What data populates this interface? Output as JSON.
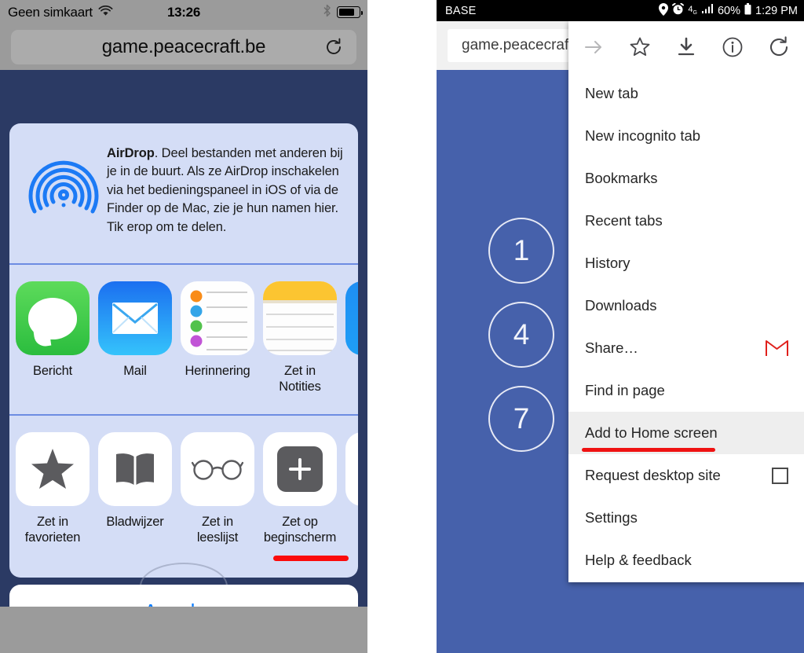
{
  "ios": {
    "status_bar": {
      "carrier": "Geen simkaart",
      "wifi_icon": "wifi-icon",
      "time": "13:26",
      "bluetooth_icon": "bluetooth-icon",
      "battery_icon": "battery-icon"
    },
    "browser": {
      "url": "game.peacecraft.be",
      "reload_icon": "reload-icon"
    },
    "share_sheet": {
      "airdrop": {
        "icon": "airdrop-icon",
        "title": "AirDrop",
        "body": ". Deel bestanden met anderen bij je in de buurt. Als ze AirDrop inschakelen via het bedieningspaneel in iOS of via de Finder op de Mac, zie je hun namen hier. Tik erop om te delen."
      },
      "apps": [
        {
          "label": "Bericht",
          "icon": "messages-icon"
        },
        {
          "label": "Mail",
          "icon": "mail-icon"
        },
        {
          "label": "Herinnering",
          "icon": "reminders-icon"
        },
        {
          "label": "Zet in Notities",
          "icon": "notes-icon"
        },
        {
          "label": "",
          "icon": "more-apps-icon"
        }
      ],
      "actions": [
        {
          "label": "Zet in favorieten",
          "icon": "star-icon"
        },
        {
          "label": "Bladwijzer",
          "icon": "book-icon"
        },
        {
          "label": "Zet in leeslijst",
          "icon": "glasses-icon"
        },
        {
          "label": "Zet op beginscherm",
          "icon": "plus-square-icon",
          "annotated": true
        },
        {
          "label": "",
          "icon": "more-actions-icon"
        }
      ],
      "cancel_label": "Annuleer"
    },
    "annotation_color": "#fb0b0b"
  },
  "android": {
    "status_bar": {
      "carrier": "BASE",
      "location_icon": "location-pin-icon",
      "alarm_icon": "alarm-clock-icon",
      "network_icon": "4g-lte-icon",
      "signal_icon": "signal-bars-icon",
      "battery_percent": "60%",
      "battery_icon": "battery-icon",
      "time": "1:29 PM"
    },
    "browser": {
      "url": "game.peacecraft.b"
    },
    "page_numbers": [
      "1",
      "4",
      "7"
    ],
    "menu": {
      "icons": [
        {
          "name": "forward-arrow-icon",
          "dim": true
        },
        {
          "name": "star-bookmark-icon",
          "dim": false
        },
        {
          "name": "download-icon",
          "dim": false
        },
        {
          "name": "page-info-icon",
          "dim": false
        },
        {
          "name": "reload-icon",
          "dim": false
        }
      ],
      "items": [
        {
          "label": "New tab",
          "highlight": false,
          "trailing": ""
        },
        {
          "label": "New incognito tab",
          "highlight": false,
          "trailing": ""
        },
        {
          "label": "Bookmarks",
          "highlight": false,
          "trailing": ""
        },
        {
          "label": "Recent tabs",
          "highlight": false,
          "trailing": ""
        },
        {
          "label": "History",
          "highlight": false,
          "trailing": ""
        },
        {
          "label": "Downloads",
          "highlight": false,
          "trailing": ""
        },
        {
          "label": "Share…",
          "highlight": false,
          "trailing": "gmail-icon"
        },
        {
          "label": "Find in page",
          "highlight": false,
          "trailing": ""
        },
        {
          "label": "Add to Home screen",
          "highlight": true,
          "trailing": "",
          "annotated": true
        },
        {
          "label": "Request desktop site",
          "highlight": false,
          "trailing": "checkbox"
        },
        {
          "label": "Settings",
          "highlight": false,
          "trailing": ""
        },
        {
          "label": "Help & feedback",
          "highlight": false,
          "trailing": ""
        }
      ]
    },
    "annotation_color": "#ef1212"
  }
}
